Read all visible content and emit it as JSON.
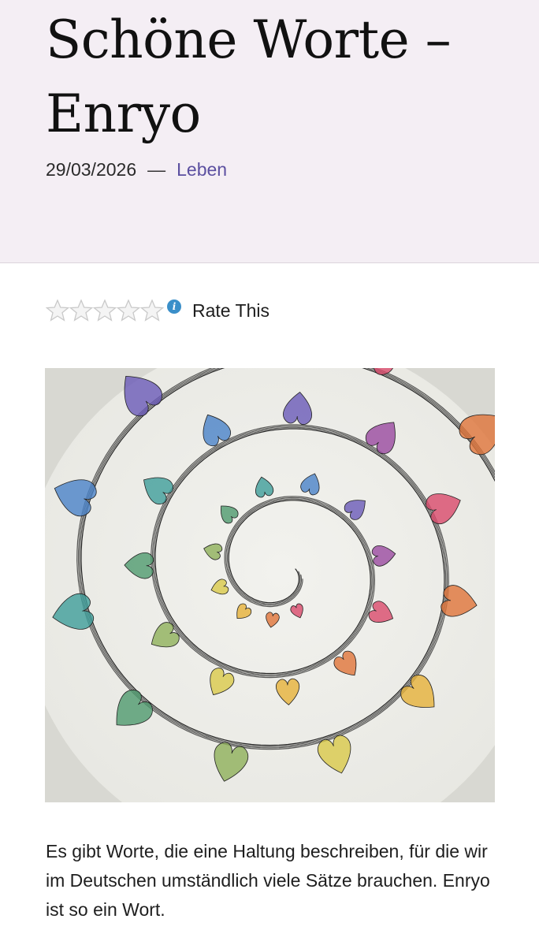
{
  "post": {
    "title_line1": "Schöne Worte –",
    "title_line2": "Enryo",
    "date": "29/03/2026",
    "separator": "—",
    "category": "Leben"
  },
  "rating": {
    "stars_filled": 0,
    "stars_total": 5,
    "info_symbol": "i",
    "label": "Rate This"
  },
  "image": {
    "subject_icon": "watercolor-heart-spiral-drawing",
    "colors": [
      "#d94a6b",
      "#e0743a",
      "#e6b23a",
      "#d9c94a",
      "#8fb05a",
      "#4f9a6e",
      "#3f9d9a",
      "#4a82c8",
      "#6a5ab8",
      "#9a4aa0"
    ]
  },
  "article": {
    "paragraph": "Es gibt Worte, die eine Haltung beschreiben, für die wir im Deutschen umständlich viele Sätze brauchen. Enryo ist so ein Wort."
  },
  "colors": {
    "hero_bg": "#f4eef4",
    "link": "#5b4fa0",
    "info_icon": "#3a8fc9"
  }
}
